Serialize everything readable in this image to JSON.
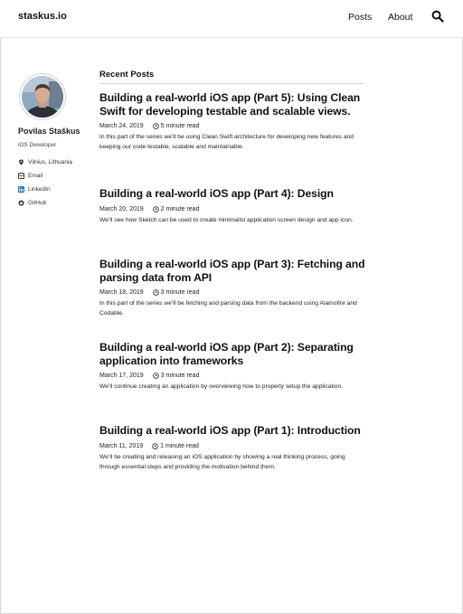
{
  "header": {
    "brand": "staskus.io",
    "nav": {
      "posts": "Posts",
      "about": "About"
    },
    "search_icon": "search-icon"
  },
  "sidebar": {
    "name": "Povilas Staškus",
    "role": "iOS Developer",
    "links": [
      {
        "icon": "location-pin-icon",
        "label": "Vilnius, Lithuania"
      },
      {
        "icon": "email-icon",
        "label": "Email"
      },
      {
        "icon": "linkedin-icon",
        "label": "LinkedIn"
      },
      {
        "icon": "github-icon",
        "label": "GitHub"
      }
    ]
  },
  "main": {
    "section_title": "Recent Posts",
    "posts": [
      {
        "title": "Building a real-world iOS app (Part 5): Using Clean Swift for developing testable and scalable views.",
        "date": "March 24, 2019",
        "read_time": "5 minute read",
        "excerpt": "In this part of the series we’ll be using Clean Swift architecture for developing new features and keeping our code testable, scalable and maintainable."
      },
      {
        "title": "Building a real-world iOS app (Part 4): Design",
        "date": "March 20, 2019",
        "read_time": "2 minute read",
        "excerpt": "We’ll see how Sketch can be used to create minimalist application screen design and app icon."
      },
      {
        "title": "Building a real-world iOS app (Part 3): Fetching and parsing data from API",
        "date": "March 18, 2019",
        "read_time": "3 minute read",
        "excerpt": "In this part of the series we’ll be fetching and parsing data from the backend using Alamofire and Codable."
      },
      {
        "title": "Building a real-world iOS app (Part 2): Separating application into frameworks",
        "date": "March 17, 2019",
        "read_time": "3 minute read",
        "excerpt": "We’ll continue creating an application by overviewing how to properly setup the application."
      },
      {
        "title": "Building a real-world iOS app (Part 1): Introduction",
        "date": "March 11, 2019",
        "read_time": "1 minute read",
        "excerpt": "We’ll be creating and releasing an iOS application by showing a real thinking process, going through essential steps and providing the motivation behind them."
      }
    ]
  }
}
